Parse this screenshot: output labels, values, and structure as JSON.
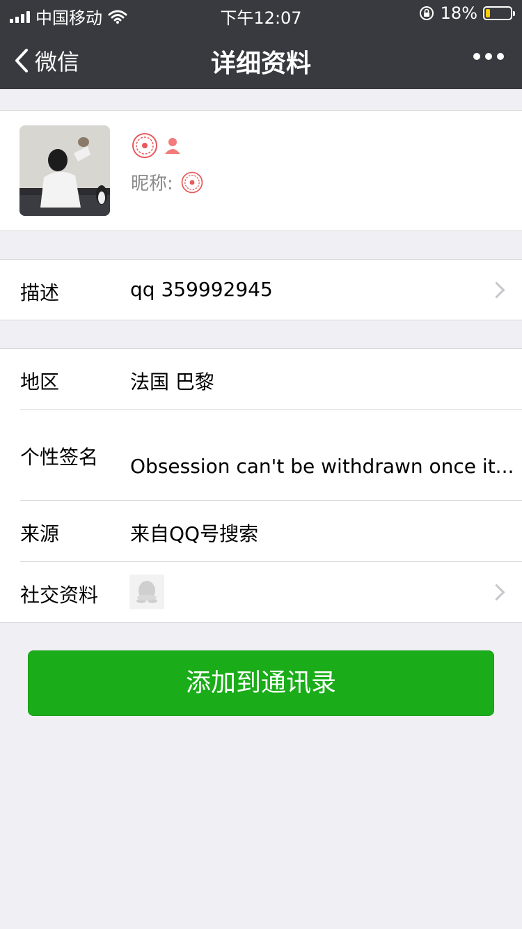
{
  "status_bar": {
    "carrier": "中国移动",
    "time": "下午12:07",
    "battery_percent": "18%",
    "battery_level": 0.18
  },
  "nav": {
    "back_label": "微信",
    "title": "详细资料"
  },
  "profile": {
    "nickname_label": "昵称:"
  },
  "description": {
    "label": "描述",
    "value": "qq 359992945"
  },
  "details": [
    {
      "label": "地区",
      "value": "法国 巴黎"
    },
    {
      "label": "个性签名",
      "value": "Obsession can't be withdrawn once it..."
    },
    {
      "label": "来源",
      "value": "来自QQ号搜索"
    },
    {
      "label": "社交资料",
      "icon": "qq-penguin-icon"
    }
  ],
  "action": {
    "add_label": "添加到通讯录"
  },
  "colors": {
    "nav_bg": "#393a3f",
    "page_bg": "#efeff4",
    "primary_green": "#1aad19",
    "badge_red": "#e8585a"
  }
}
